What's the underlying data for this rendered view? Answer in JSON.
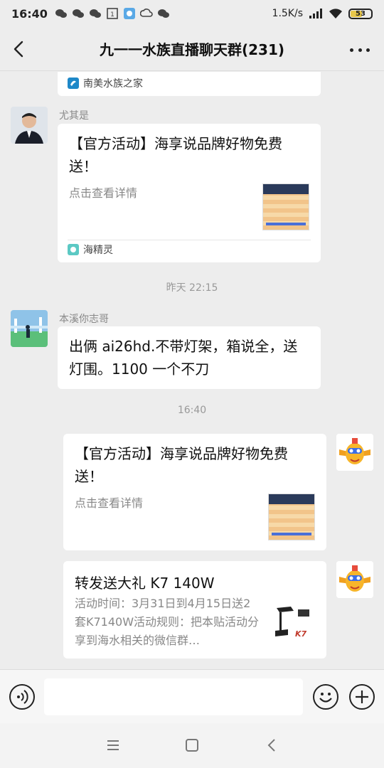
{
  "status_bar": {
    "time": "16:40",
    "network_speed": "1.5K/s",
    "battery": "53",
    "icons": [
      "wechat-icon",
      "wechat-icon",
      "wechat-icon",
      "calendar-icon",
      "app-icon",
      "cloud-icon",
      "wechat-icon",
      "signal-icon",
      "wifi-icon",
      "battery-icon"
    ]
  },
  "header": {
    "title": "九一一水族直播聊天群(231)",
    "back_icon": "chevron-left-icon",
    "more_icon": "more-dots-icon"
  },
  "messages": {
    "partial_card": {
      "source": "南美水族之家"
    },
    "msg1": {
      "sender": "尤其是",
      "title": "【官方活动】海享说品牌好物免费送！",
      "subtitle": "点击查看详情",
      "source": "海精灵"
    },
    "time1": "昨天 22:15",
    "msg2": {
      "sender": "本溪你志哥",
      "text": "出俩 ai26hd.不带灯架，箱说全，送灯围。1100 一个不刀"
    },
    "time2": "16:40",
    "msg3": {
      "title": "【官方活动】海享说品牌好物免费送！",
      "subtitle": "点击查看详情"
    },
    "msg4": {
      "title": "转发送大礼 K7 140W",
      "desc": "活动时间：3月31日到4月15日送2套K7140W活动规则：把本贴活动分享到海水相关的微信群…",
      "thumb_text": "K7"
    }
  },
  "input_bar": {
    "voice_icon": "voice-icon",
    "emoji_icon": "emoji-icon",
    "plus_icon": "plus-icon"
  },
  "system_nav": {
    "menu_icon": "menu-icon",
    "home_icon": "home-square-icon",
    "back_icon": "back-triangle-icon"
  }
}
